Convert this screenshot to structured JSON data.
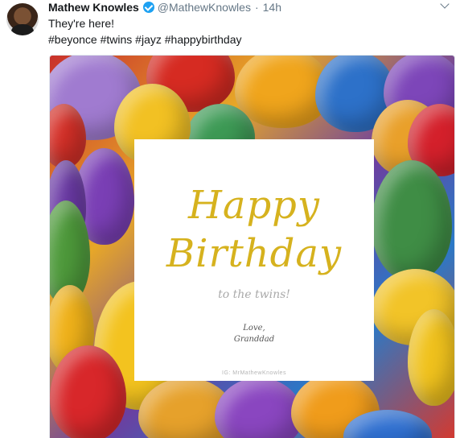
{
  "tweet": {
    "author_name": "Mathew Knowles",
    "handle": "@MathewKnowles",
    "separator": "·",
    "time": "14h",
    "text": "They're here!",
    "hashtags": "#beyonce #twins #jayz #happybirthday"
  },
  "media": {
    "line1": "Happy",
    "line2": "Birthday",
    "subtitle": "to the twins!",
    "sign_off": "Love,",
    "signature": "Granddad",
    "watermark": "IG: MrMathewKnowles"
  },
  "icons": {
    "verified": "verified-badge-icon",
    "menu": "chevron-down-icon"
  },
  "colors": {
    "verified_blue": "#1da1f2",
    "birthday_gold": "#d6b21e",
    "secondary_text": "#657786"
  }
}
